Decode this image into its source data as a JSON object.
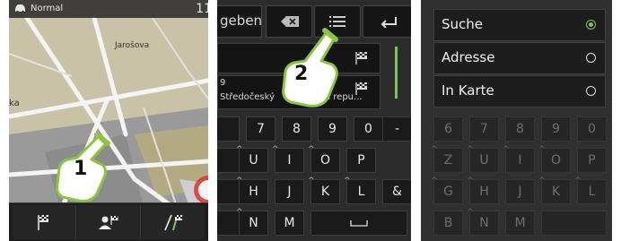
{
  "panel1": {
    "status_mode": "Normal",
    "status_time": "11",
    "map_labels": {
      "town": "Jarošova",
      "left_edge": "ka"
    },
    "bottom_buttons": [
      {
        "icon": "checkered-flag-icon"
      },
      {
        "icon": "person-flag-icon"
      },
      {
        "icon": "route-flag-icon"
      }
    ],
    "callout_number": "1"
  },
  "panel2": {
    "header_text": "geben",
    "row1_text": "",
    "row2_line1": "9",
    "row2_line2": "Středočeský",
    "row2_line3": "eská repu...",
    "callout_number": "2",
    "keys_row1": [
      "",
      "7",
      "8",
      "9",
      "0",
      "-"
    ],
    "keys_row2": [
      "",
      "U",
      "I",
      "O",
      "P"
    ],
    "keys_row3": [
      "",
      "H",
      "J",
      "K",
      "L",
      "&"
    ],
    "keys_row4": [
      "",
      "N",
      "M"
    ]
  },
  "panel3": {
    "menu": [
      {
        "label": "Suche",
        "selected": true
      },
      {
        "label": "Adresse",
        "selected": false
      },
      {
        "label": "In Karte",
        "selected": false
      }
    ],
    "keys_row1": [
      "6",
      "7",
      "8",
      "9",
      "0"
    ],
    "keys_row2": [
      "Z",
      "U",
      "I",
      "O",
      "P"
    ],
    "keys_row3": [
      "G",
      "H",
      "J",
      "K",
      "L"
    ],
    "keys_row4": [
      "B",
      "N",
      "M"
    ]
  },
  "colors": {
    "accent_green": "#7ec25a",
    "callout_green": "#8cc63f"
  }
}
